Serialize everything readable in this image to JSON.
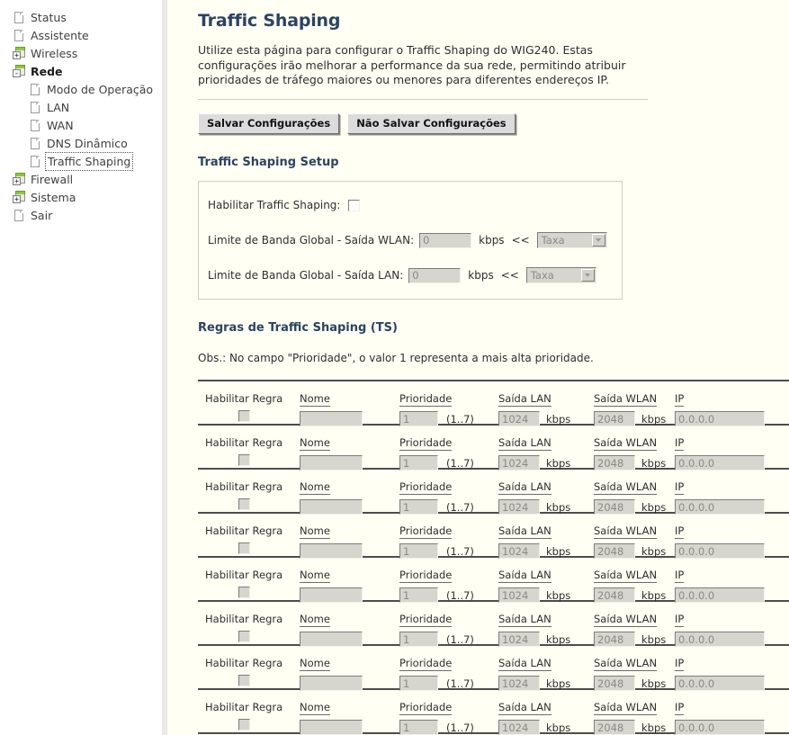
{
  "sidebar": {
    "items": [
      {
        "label": "Status",
        "icon": "page-icon",
        "level": 1,
        "expander": "",
        "selected": false,
        "bold": false
      },
      {
        "label": "Assistente",
        "icon": "page-icon",
        "level": 1,
        "expander": "",
        "selected": false,
        "bold": false
      },
      {
        "label": "Wireless",
        "icon": "folder-icon",
        "level": 1,
        "expander": "+",
        "selected": false,
        "bold": false
      },
      {
        "label": "Rede",
        "icon": "folder-icon",
        "level": 1,
        "expander": "-",
        "selected": false,
        "bold": true
      },
      {
        "label": "Modo de Operação",
        "icon": "page-icon",
        "level": 2,
        "expander": "",
        "selected": false,
        "bold": false
      },
      {
        "label": "LAN",
        "icon": "page-icon",
        "level": 2,
        "expander": "",
        "selected": false,
        "bold": false
      },
      {
        "label": "WAN",
        "icon": "page-icon",
        "level": 2,
        "expander": "",
        "selected": false,
        "bold": false
      },
      {
        "label": "DNS Dinâmico",
        "icon": "page-icon",
        "level": 2,
        "expander": "",
        "selected": false,
        "bold": false
      },
      {
        "label": "Traffic Shaping",
        "icon": "page-icon",
        "level": 2,
        "expander": "",
        "selected": true,
        "bold": false
      },
      {
        "label": "Firewall",
        "icon": "folder-icon",
        "level": 1,
        "expander": "+",
        "selected": false,
        "bold": false
      },
      {
        "label": "Sistema",
        "icon": "folder-icon",
        "level": 1,
        "expander": "+",
        "selected": false,
        "bold": false
      },
      {
        "label": "Sair",
        "icon": "page-icon",
        "level": 1,
        "expander": "",
        "selected": false,
        "bold": false
      }
    ]
  },
  "page": {
    "title": "Traffic Shaping",
    "description": "Utilize esta página para configurar o Traffic Shaping do WIG240. Estas configurações irão melhorar a performance da sua rede, permitindo atribuir prioridades de tráfego maiores ou menores para diferentes endereços IP."
  },
  "buttons": {
    "save": "Salvar Configurações",
    "cancel": "Não Salvar Configurações"
  },
  "setup": {
    "heading": "Traffic Shaping Setup",
    "enable_label": "Habilitar Traffic Shaping:",
    "enable_checked": false,
    "wlan": {
      "label": "Limite de Banda Global - Saída WLAN:",
      "value": "0",
      "unit": "kbps",
      "separator": "<<",
      "select_value": "Taxa"
    },
    "lan": {
      "label": "Limite de Banda Global - Saída LAN:",
      "value": "0",
      "unit": "kbps",
      "separator": "<<",
      "select_value": "Taxa"
    }
  },
  "rules_section": {
    "heading": "Regras de Traffic Shaping (TS)",
    "note": "Obs.: No campo \"Prioridade\", o valor 1 representa a mais alta prioridade.",
    "columns": {
      "enable": "Habilitar Regra",
      "name": "Nome",
      "priority": "Prioridade",
      "lan": "Saída LAN",
      "wlan": "Saída WLAN",
      "ip": "IP"
    },
    "priority_hint": "(1..7)",
    "unit": "kbps",
    "rows": [
      {
        "enabled": false,
        "name": "",
        "priority": "1",
        "lan": "1024",
        "wlan": "2048",
        "ip": "0.0.0.0"
      },
      {
        "enabled": false,
        "name": "",
        "priority": "1",
        "lan": "1024",
        "wlan": "2048",
        "ip": "0.0.0.0"
      },
      {
        "enabled": false,
        "name": "",
        "priority": "1",
        "lan": "1024",
        "wlan": "2048",
        "ip": "0.0.0.0"
      },
      {
        "enabled": false,
        "name": "",
        "priority": "1",
        "lan": "1024",
        "wlan": "2048",
        "ip": "0.0.0.0"
      },
      {
        "enabled": false,
        "name": "",
        "priority": "1",
        "lan": "1024",
        "wlan": "2048",
        "ip": "0.0.0.0"
      },
      {
        "enabled": false,
        "name": "",
        "priority": "1",
        "lan": "1024",
        "wlan": "2048",
        "ip": "0.0.0.0"
      },
      {
        "enabled": false,
        "name": "",
        "priority": "1",
        "lan": "1024",
        "wlan": "2048",
        "ip": "0.0.0.0"
      },
      {
        "enabled": false,
        "name": "",
        "priority": "1",
        "lan": "1024",
        "wlan": "2048",
        "ip": "0.0.0.0"
      }
    ]
  },
  "colors": {
    "content_bg": "#fffff4",
    "title": "#2c4360",
    "accent_green": "#8dc63f",
    "separator": "#4d4d4d"
  }
}
